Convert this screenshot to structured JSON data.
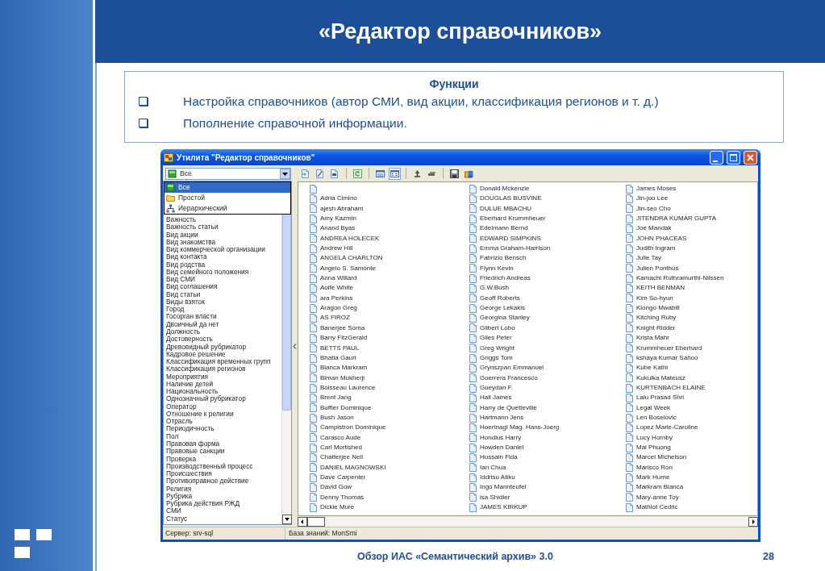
{
  "slide": {
    "title": "«Редактор справочников»",
    "functions": {
      "heading": "Функции",
      "items": [
        "Настройка справочников (автор СМИ, вид акции, классификация регионов и т. д.)",
        "Пополнение справочной информации."
      ]
    },
    "footer": "Обзор ИАС «Семантический архив» 3.0",
    "page_number": "28"
  },
  "window": {
    "title": "Утилита \"Редактор справочников\"",
    "filter": {
      "value": "Все",
      "kind": "all",
      "options": [
        {
          "label": "Все",
          "kind": "all",
          "selected": true
        },
        {
          "label": "Простой",
          "kind": "simple",
          "selected": false
        },
        {
          "label": "Иерархический",
          "kind": "hierarchical",
          "selected": false
        }
      ]
    },
    "dictionaries": [
      "Важность",
      "Важность статьи",
      "Вид акции",
      "Вид знакомства",
      "Вид коммерческой организации",
      "Вид контакта",
      "Вид родства",
      "Вид семейного положения",
      "Вид СМИ",
      "Вид соглашения",
      "Вид статьи",
      "Виды взяток",
      "Город",
      "Госорган власти",
      "Двоичный да нет",
      "Должность",
      "Достоверность",
      "Древовидный рубрикатор",
      "Кадровое решение",
      "Классификация временных групп",
      "Классификация регионов",
      "Мероприятия",
      "Наличие детей",
      "Национальность",
      "Однозначный рубрикатор",
      "Оператор",
      "Отношение к религии",
      "Отрасль",
      "Периодичность",
      "Пол",
      "Правовая форма",
      "Правовые санкции",
      "Проверка",
      "Производственный процесс",
      "Происшествия",
      "Противоправное действие",
      "Религия",
      "Рубрика",
      "Рубрика действия РЖД",
      "СМИ",
      "Статус"
    ],
    "view_modes": [
      {
        "kind": "list",
        "selected": false
      },
      {
        "kind": "details",
        "selected": true
      }
    ],
    "record_columns": [
      {
        "leading_blank_icon": true,
        "names": [
          "Adria Cimino",
          "ajesh Abraham",
          "Amy Kazmin",
          "Anand Byas",
          "ANDREA HOLECEK",
          "Andrew Hill",
          "ANGELA CHARLTON",
          "Angelo S. Samonte",
          "Anna Willard",
          "Aoife White",
          "ara Perkins",
          "Aragon Greg",
          "AS FIROZ",
          "Banerjee Soma",
          "Barry FitzGerald",
          "BETTS PAUL",
          "Bhatia Gauri",
          "Bianca Markram",
          "Biman Mukherji",
          "Boisseau Laurence",
          "Brent Jang",
          "Buffier Dominique",
          "Bush Jason",
          "Campistron Dominique",
          "Carasco Aude",
          "Carl Mortished",
          "Chatterjee Neil",
          "DANIEL MAGNOWSKI",
          "Dave Carpenter",
          "David Gow",
          "Denny Thomas",
          "Dickie Mure"
        ]
      },
      {
        "leading_blank_icon": false,
        "names": [
          "Donald Mckenzie",
          "DOUGLAS BUSVINE",
          "DULUE MBACHU",
          "Eberhard Krummheuer",
          "Edelmann Bernd",
          "EDWARD SIMPKINS",
          "Emma Graham-Harrison",
          "Fabrizio Bensch",
          "Flynn Kevin",
          "Friedrich Andreas",
          "G.W.Bush",
          "Geoff Roberts",
          "George Lekakis",
          "Georgina Stanley",
          "Gilbert Lobo",
          "Giles Peter",
          "Greg Wright",
          "Griggs Tom",
          "Grynszpan Emmanuel",
          "Guerrera Francesco",
          "Gueydan F.",
          "Hall James",
          "Harry de Quetteville",
          "Hartmann Jens",
          "Hoertnagl Mag. Hans-Joerg",
          "Hondius Harry",
          "Howden Daniel",
          "Hussain Fida",
          "Ian Chua",
          "Iddrisu Atiku",
          "Ingo Mannteufel",
          "isa Shidler",
          "JAMES KIRKUP"
        ]
      },
      {
        "leading_blank_icon": false,
        "names": [
          "James Moses",
          "Jin-joo Lee",
          "Jin-seo Cho",
          "JITENDRA KUMAR GUPTA",
          "Joe Mandak",
          "JOHN PHACEAS",
          "Judith Ingram",
          "Julie Tay",
          "Julien Ponthus",
          "Kamachi Ruthramurthi-Nilssen",
          "KEITH BENMAN",
          "Kim So-hyun",
          "Kiongo Mwabili",
          "Kitching Ruby",
          "Knight Ridder",
          "Krista Mahr",
          "Krummheuer Eberhard",
          "kshaya Kumar Sahoo",
          "Kube Kathi",
          "Kukulka Mateusz",
          "KURTENBACH ELAINE",
          "Lalu Prasad Shri",
          "Legal Week",
          "Len Boselovic",
          "Lopez Marie-Caroline",
          "Lucy Hornby",
          "Mai Phuong",
          "Marcel Michelson",
          "Marisco Ron",
          "Mark Hume",
          "Markram Bianca",
          "Mary-anne Toy",
          "Mathiot Cedric"
        ]
      }
    ],
    "status": {
      "server": "Сервер: srv-sql",
      "knowledge_base": "База знаний: MonSmi"
    }
  }
}
